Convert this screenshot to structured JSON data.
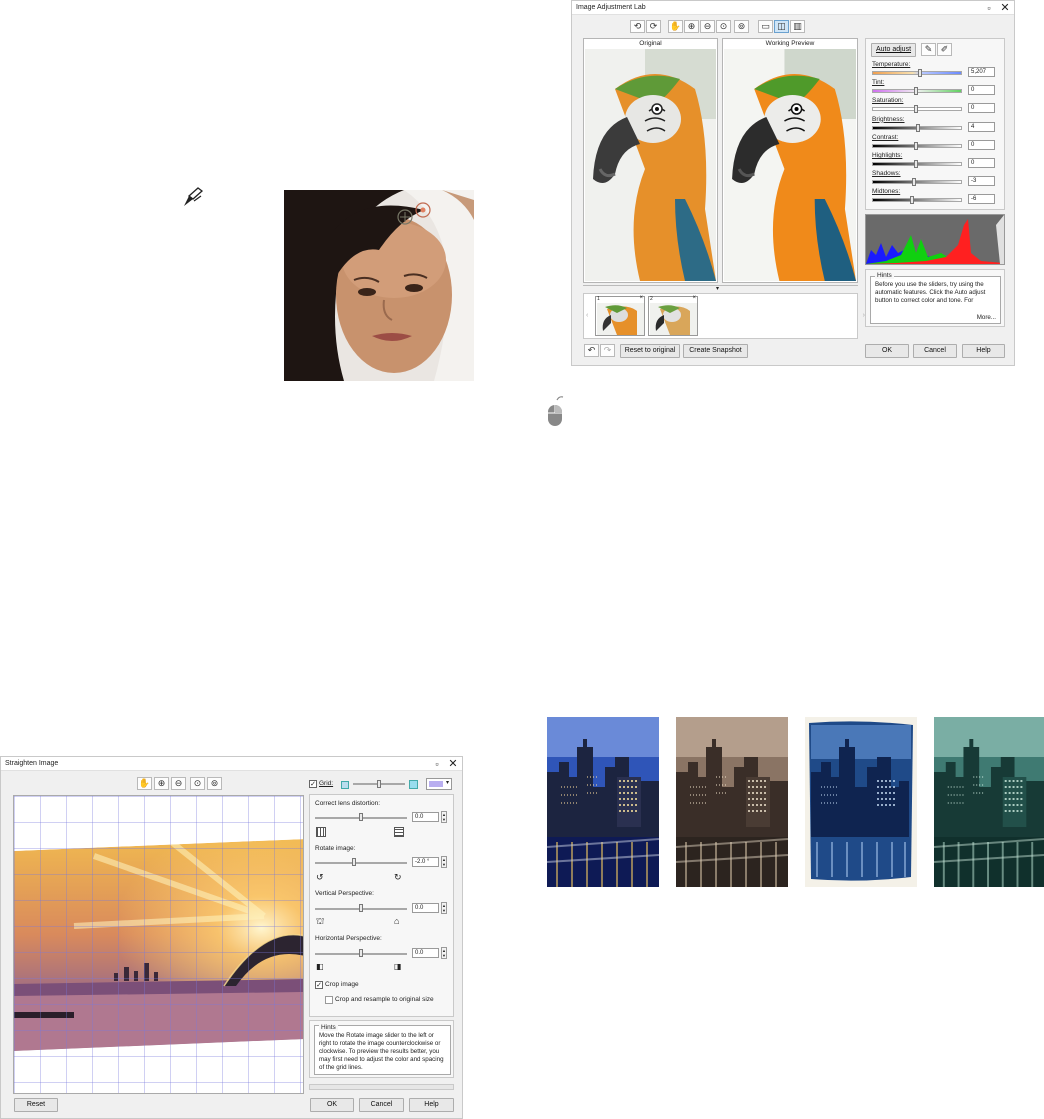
{
  "image_adjustment_lab": {
    "title": "Image Adjustment Lab",
    "original_label": "Original",
    "preview_label": "Working Preview",
    "auto_adjust": "Auto adjust",
    "sliders": [
      {
        "label": "Temperature:",
        "value": "5,207",
        "level": 0.55
      },
      {
        "label": "Tint:",
        "value": "0",
        "level": 0.5
      },
      {
        "label": "Saturation:",
        "value": "0",
        "level": 0.5
      },
      {
        "label": "Brightness:",
        "value": "4",
        "level": 0.52
      },
      {
        "label": "Contrast:",
        "value": "0",
        "level": 0.5
      },
      {
        "label": "Highlights:",
        "value": "0",
        "level": 0.5
      },
      {
        "label": "Shadows:",
        "value": "-3",
        "level": 0.48
      },
      {
        "label": "Midtones:",
        "value": "-6",
        "level": 0.46
      }
    ],
    "snapshots": [
      "1",
      "2"
    ],
    "hints_caption": "Hints",
    "hints_text": "Before you use the sliders, try using the automatic features. Click the Auto adjust button to correct color and tone. For",
    "more_label": "More...",
    "reset_label": "Reset to original",
    "snapshot_label": "Create Snapshot",
    "ok_label": "OK",
    "cancel_label": "Cancel",
    "help_label": "Help"
  },
  "straighten_image": {
    "title": "Straighten Image",
    "grid_label": "Grid:",
    "lens_label": "Correct lens distortion:",
    "lens_value": "0.0",
    "rotate_label": "Rotate image:",
    "rotate_value": "-2.0 °",
    "vertical_label": "Vertical Perspective:",
    "vertical_value": "0.0",
    "horizontal_label": "Horizontal Perspective:",
    "horizontal_value": "0.0",
    "crop_label": "Crop image",
    "resample_label": "Crop and resample to original size",
    "hints_caption": "Hints",
    "hints_text": "Move the Rotate image slider to the left or right to rotate the image counterclockwise or clockwise. To preview the results better, you may first need to adjust the color and spacing of the grid lines.",
    "reset_label": "Reset",
    "ok_label": "OK",
    "cancel_label": "Cancel",
    "help_label": "Help"
  },
  "icons": [
    "touch-up-brush-icon",
    "mouse-click-icon",
    "rotate-left-icon",
    "rotate-right-icon",
    "hand-pan-icon",
    "zoom-in-icon",
    "zoom-out-icon",
    "zoom-fit-icon",
    "zoom-actual-icon",
    "eyedropper-icon"
  ],
  "colors": {
    "accent": "#6aa1cf",
    "dialog_bg": "#f0f0f0"
  }
}
